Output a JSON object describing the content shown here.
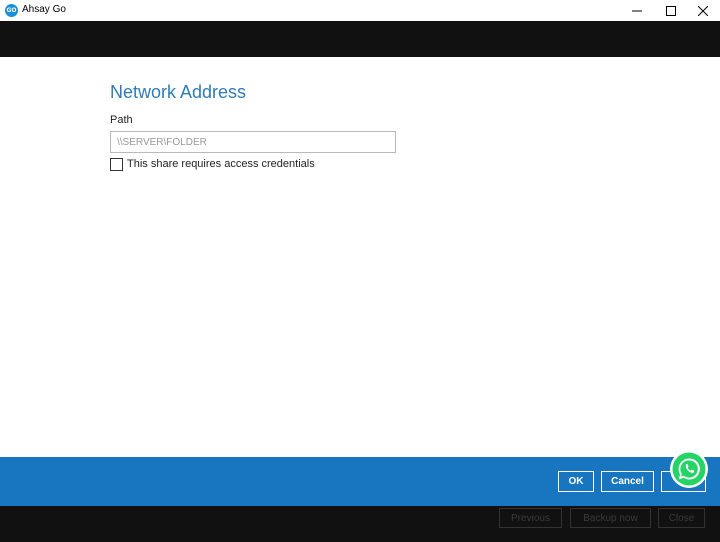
{
  "window": {
    "logo_text": "GO",
    "title": "Ahsay Go"
  },
  "dialog": {
    "title": "Network Address",
    "path_label": "Path",
    "path_placeholder": "\\\\SERVER\\FOLDER",
    "path_value": "",
    "credentials_label": "This share requires access credentials",
    "credentials_checked": false
  },
  "footer": {
    "ok_label": "OK",
    "cancel_label": "Cancel"
  },
  "background_buttons": {
    "previous_label": "Previous",
    "backup_now_label": "Backup now",
    "close_label": "Close"
  },
  "colors": {
    "accent": "#2f7cb6",
    "footer_blue": "#1876c0",
    "dark_strip": "#111111",
    "whatsapp_green": "#25d366"
  },
  "icons": {
    "app": "ahsay-go-logo-icon",
    "minimize": "minimize-icon",
    "maximize": "maximize-icon",
    "close": "close-icon",
    "floating": "whatsapp-icon"
  }
}
